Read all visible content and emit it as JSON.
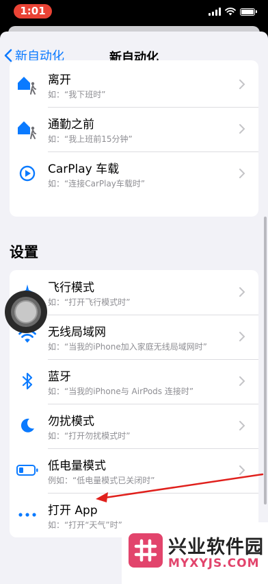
{
  "status_bar": {
    "time": "1:01"
  },
  "nav": {
    "back_label": "新自动化",
    "title": "新自动化"
  },
  "location_group": {
    "items": [
      {
        "title": "离开",
        "subtitle": "如：“我下班时”"
      },
      {
        "title": "通勤之前",
        "subtitle": "如：“我上班前15分钟”"
      },
      {
        "title": "CarPlay 车载",
        "subtitle": "如：“连接CarPlay车载时”"
      }
    ]
  },
  "settings_section": {
    "header": "设置",
    "items": [
      {
        "title": "飞行模式",
        "subtitle": "如：“打开飞行模式时”"
      },
      {
        "title": "无线局域网",
        "subtitle": "如：“当我的iPhone加入家庭无线局域网时”"
      },
      {
        "title": "蓝牙",
        "subtitle": "如：“当我的iPhone与 AirPods 连接时”"
      },
      {
        "title": "勿扰模式",
        "subtitle": "如：“打开勿扰模式时”"
      },
      {
        "title": "低电量模式",
        "subtitle": "例如：“低电量模式已关闭时”"
      },
      {
        "title": "打开 App",
        "subtitle": "如：“打开“天气”时”"
      }
    ]
  },
  "watermark": {
    "name": "兴业软件园",
    "url": "MYXYJS.COM"
  },
  "colors": {
    "accent": "#0a7aff",
    "annotation_arrow": "#e0201c",
    "time_pill": "#ea4335",
    "watermark": "#e2446c"
  },
  "icons": [
    "home-leave-icon",
    "home-commute-icon",
    "carplay-icon",
    "airplane-icon",
    "wifi-icon",
    "bluetooth-icon",
    "moon-icon",
    "battery-icon",
    "more-dots-icon"
  ]
}
